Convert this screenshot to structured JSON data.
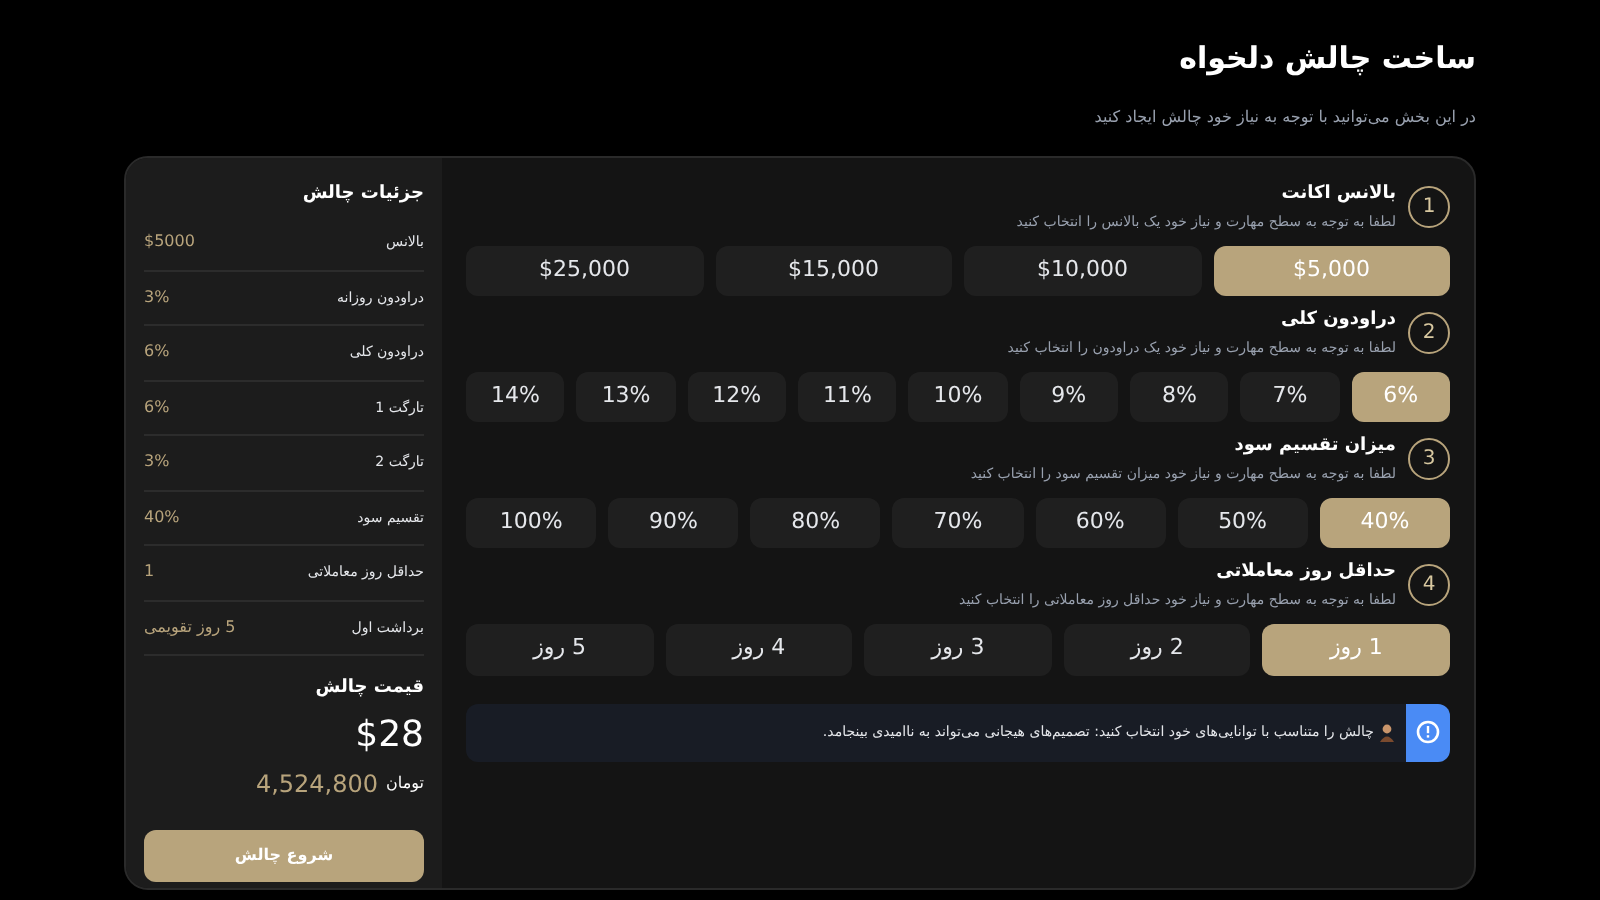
{
  "header": {
    "title": "ساخت چالش دلخواه",
    "subtitle": "در این بخش می‌توانید با توجه به نیاز خود چالش ایجاد کنید"
  },
  "steps": [
    {
      "number": "1",
      "title": "بالانس اکانت",
      "hint": "لطفا به توجه به سطح مهارت و نیاز خود یک بالانس را انتخاب کنید",
      "options": [
        {
          "label": "$5,000",
          "selected": true
        },
        {
          "label": "$10,000",
          "selected": false
        },
        {
          "label": "$15,000",
          "selected": false
        },
        {
          "label": "$25,000",
          "selected": false
        }
      ]
    },
    {
      "number": "2",
      "title": "دراودون کلی",
      "hint": "لطفا به توجه به سطح مهارت و نیاز خود یک دراودون را انتخاب کنید",
      "options": [
        {
          "label": "6%",
          "selected": true
        },
        {
          "label": "7%",
          "selected": false
        },
        {
          "label": "8%",
          "selected": false
        },
        {
          "label": "9%",
          "selected": false
        },
        {
          "label": "10%",
          "selected": false
        },
        {
          "label": "11%",
          "selected": false
        },
        {
          "label": "12%",
          "selected": false
        },
        {
          "label": "13%",
          "selected": false
        },
        {
          "label": "14%",
          "selected": false
        }
      ]
    },
    {
      "number": "3",
      "title": "میزان تقسیم سود",
      "hint": "لطفا به توجه به سطح مهارت و نیاز خود میزان تقسیم سود را انتخاب کنید",
      "options": [
        {
          "label": "40%",
          "selected": true
        },
        {
          "label": "50%",
          "selected": false
        },
        {
          "label": "60%",
          "selected": false
        },
        {
          "label": "70%",
          "selected": false
        },
        {
          "label": "80%",
          "selected": false
        },
        {
          "label": "90%",
          "selected": false
        },
        {
          "label": "100%",
          "selected": false
        }
      ]
    },
    {
      "number": "4",
      "title": "حداقل روز معاملاتی",
      "hint": "لطفا به توجه به سطح مهارت و نیاز خود حداقل روز معاملاتی را انتخاب کنید",
      "options": [
        {
          "label": "1 روز",
          "selected": true
        },
        {
          "label": "2 روز",
          "selected": false
        },
        {
          "label": "3 روز",
          "selected": false
        },
        {
          "label": "4 روز",
          "selected": false
        },
        {
          "label": "5 روز",
          "selected": false
        }
      ]
    }
  ],
  "notice": {
    "text": "چالش را متناسب با توانایی‌های خود انتخاب کنید: تصمیم‌های هیجانی می‌تواند به ناامیدی بینجامد."
  },
  "summary": {
    "title": "جزئیات چالش",
    "rows": [
      {
        "label": "بالانس",
        "value": "$5000"
      },
      {
        "label": "دراودون روزانه",
        "value": "3%"
      },
      {
        "label": "دراودون کلی",
        "value": "6%"
      },
      {
        "label": "تارگت 1",
        "value": "6%"
      },
      {
        "label": "تارگت 2",
        "value": "3%"
      },
      {
        "label": "تقسیم سود",
        "value": "40%"
      },
      {
        "label": "حداقل روز معاملاتی",
        "value": "1"
      },
      {
        "label": "برداشت اول",
        "value": "5 روز تقویمی"
      }
    ],
    "price_label": "قیمت چالش",
    "price": "$28",
    "toman_amount": "4,524,800",
    "toman_unit": "تومان",
    "button": "شروع چالش"
  }
}
